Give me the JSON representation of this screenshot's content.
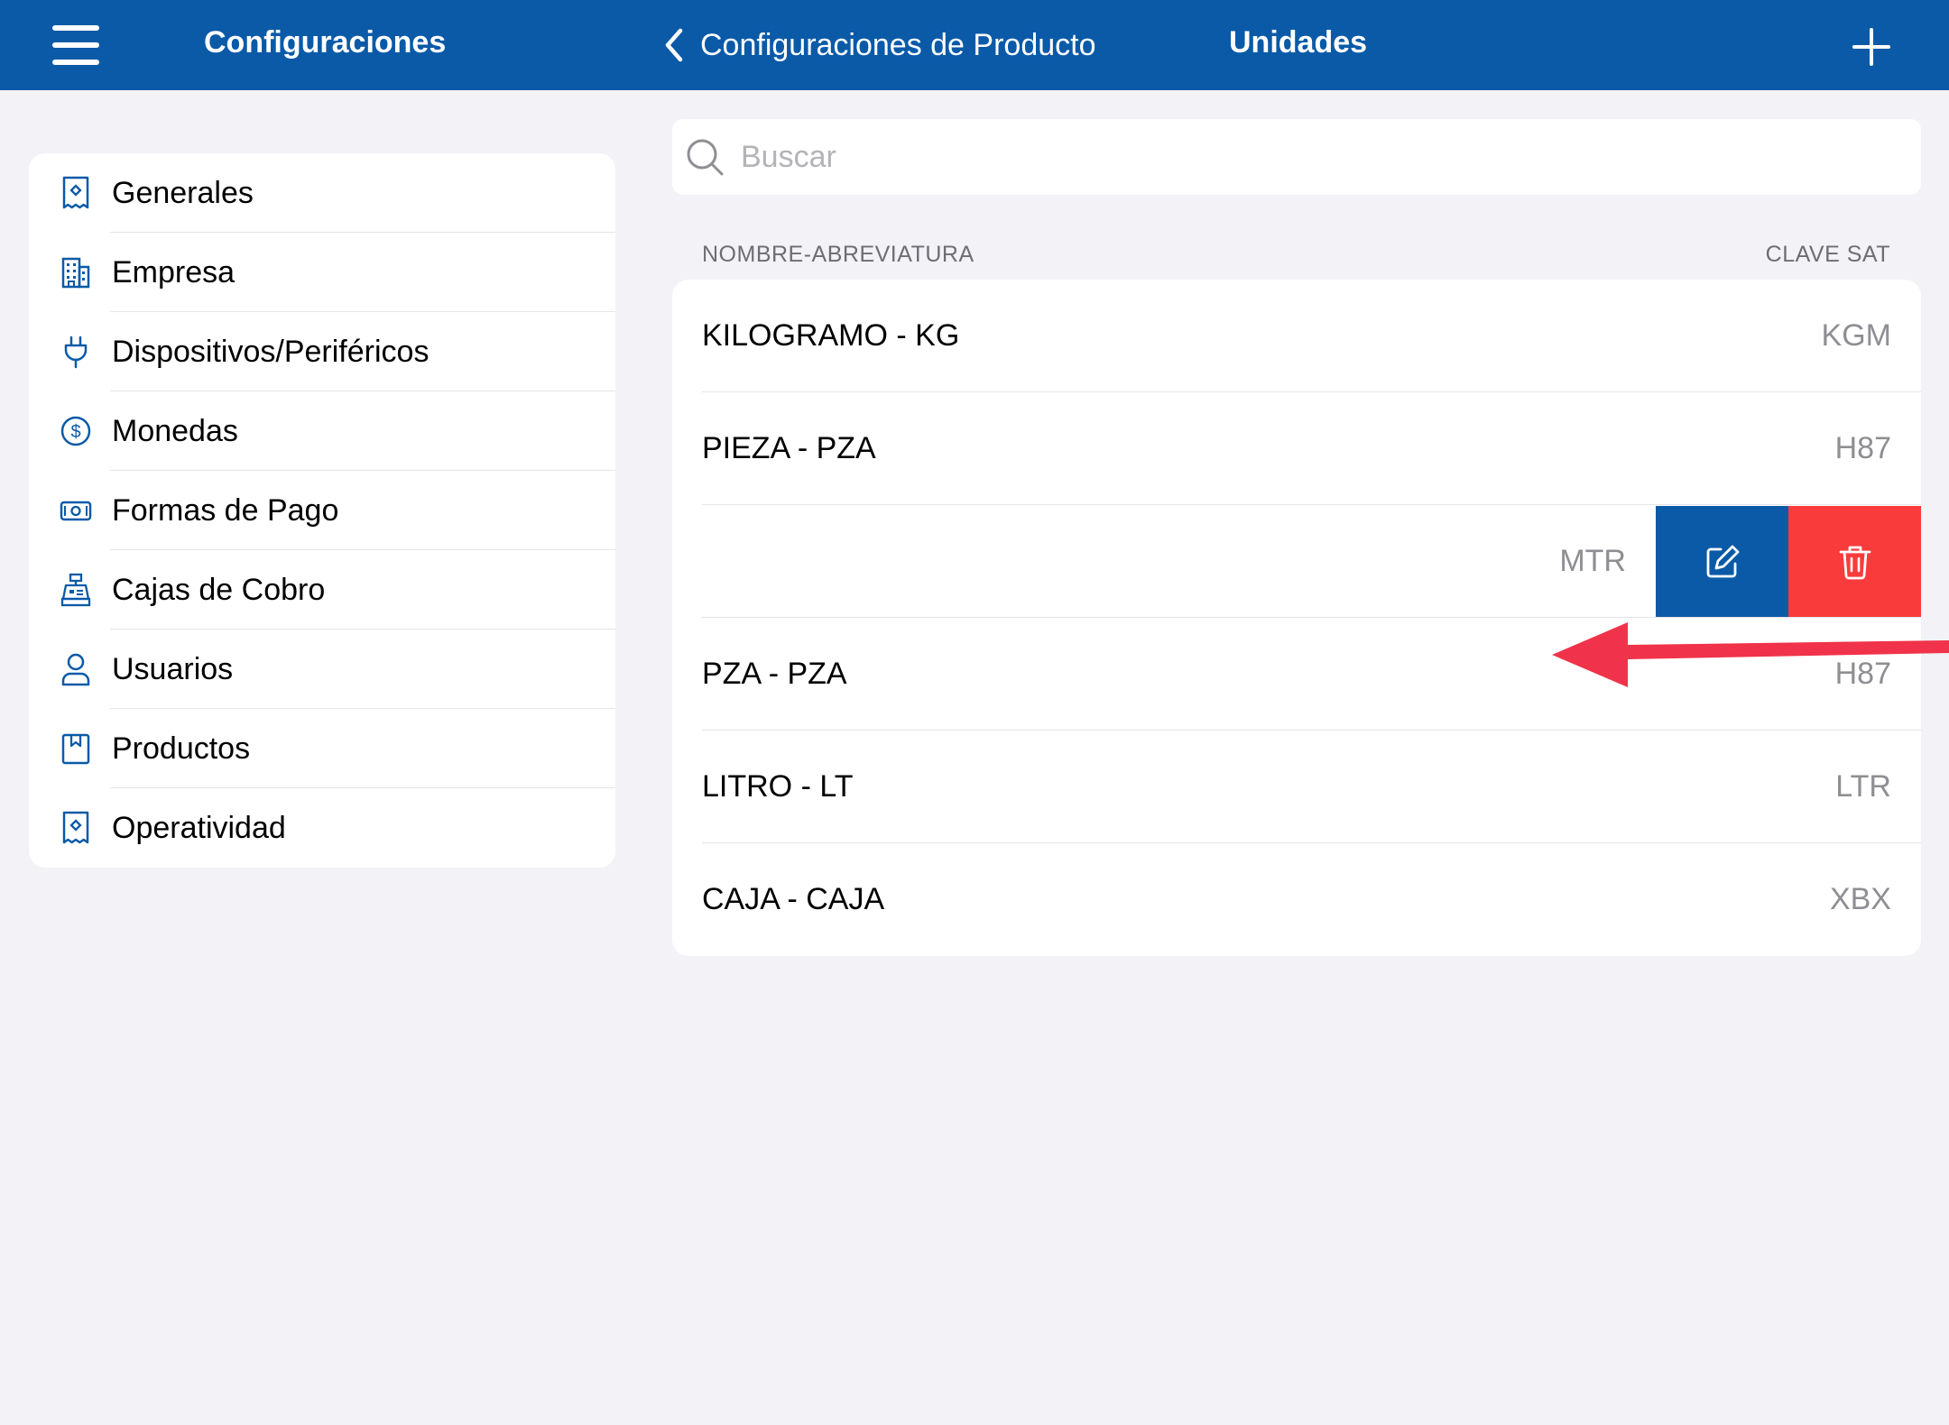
{
  "header": {
    "left_title": "Configuraciones",
    "back_label": "Configuraciones de Producto",
    "title": "Unidades"
  },
  "sidebar": {
    "items": [
      {
        "label": "Generales",
        "icon": "receipt-icon"
      },
      {
        "label": "Empresa",
        "icon": "building-icon"
      },
      {
        "label": "Dispositivos/Periféricos",
        "icon": "plug-icon"
      },
      {
        "label": "Monedas",
        "icon": "dollar-circle-icon"
      },
      {
        "label": "Formas de Pago",
        "icon": "banknote-icon"
      },
      {
        "label": "Cajas de Cobro",
        "icon": "cash-register-icon"
      },
      {
        "label": "Usuarios",
        "icon": "user-icon"
      },
      {
        "label": "Productos",
        "icon": "bookmark-box-icon"
      },
      {
        "label": "Operatividad",
        "icon": "receipt-icon"
      }
    ]
  },
  "search": {
    "placeholder": "Buscar",
    "value": ""
  },
  "list": {
    "column_name": "NOMBRE-ABREVIATURA",
    "column_code": "CLAVE SAT",
    "rows": [
      {
        "name": "KILOGRAMO - KG",
        "code": "KGM"
      },
      {
        "name": "PIEZA - PZA",
        "code": "H87"
      },
      {
        "name": "",
        "code": "MTR",
        "swiped": true
      },
      {
        "name": "PZA - PZA",
        "code": "H87"
      },
      {
        "name": "LITRO - LT",
        "code": "LTR"
      },
      {
        "name": "CAJA - CAJA",
        "code": "XBX"
      }
    ]
  },
  "colors": {
    "brand": "#0a5aa8",
    "delete": "#fa3b3b",
    "arrow": "#f0334a"
  }
}
